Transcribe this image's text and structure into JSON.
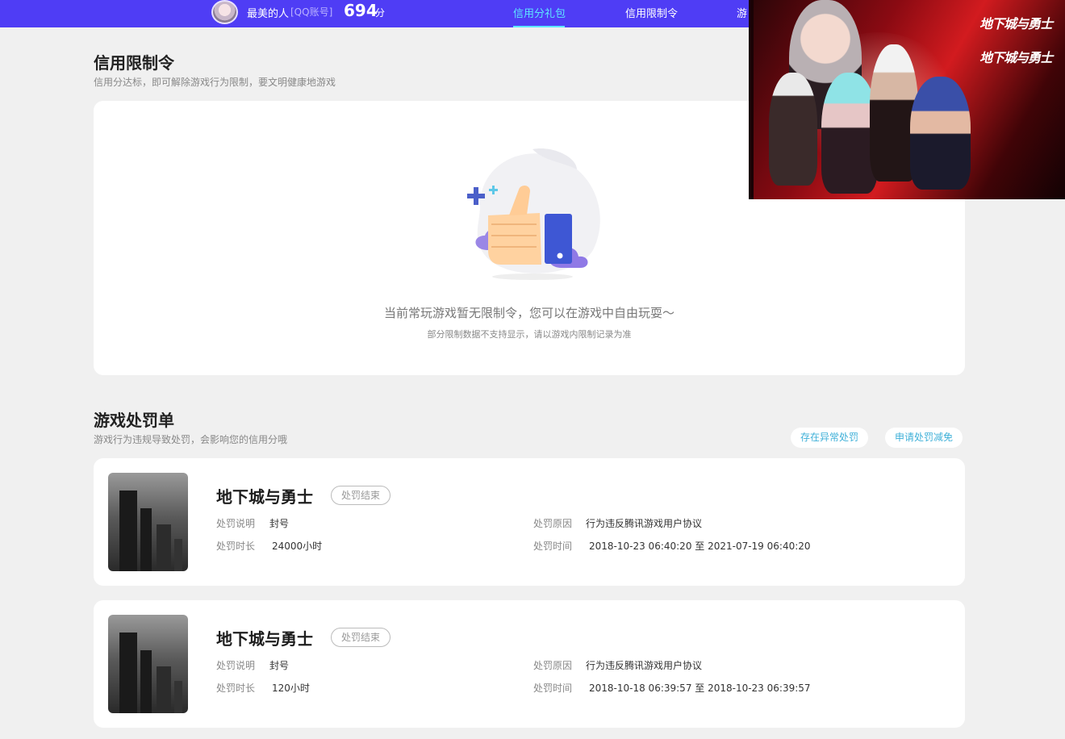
{
  "header": {
    "username": "最美的人",
    "account_tag": "[QQ账号]",
    "score": "694",
    "score_unit": "分",
    "nav": [
      {
        "label": "信用分礼包",
        "active": true
      },
      {
        "label": "信用限制令",
        "active": false
      },
      {
        "label": "游",
        "active": false
      }
    ]
  },
  "ad": {
    "logo_1": "地下城与勇士",
    "logo_2": "地下城与勇士"
  },
  "restriction": {
    "title": "信用限制令",
    "subtitle": "信用分达标，即可解除游戏行为限制，要文明健康地游戏",
    "empty_main": "当前常玩游戏暂无限制令，您可以在游戏中自由玩耍～",
    "empty_sub": "部分限制数据不支持显示，请以游戏内限制记录为准"
  },
  "punishments": {
    "title": "游戏处罚单",
    "subtitle": "游戏行为违规导致处罚，会影响您的信用分哦",
    "btn_abnormal": "存在异常处罚",
    "btn_reduce": "申请处罚减免",
    "labels": {
      "desc": "处罚说明",
      "duration": "处罚时长",
      "reason": "处罚原因",
      "time": "处罚时间"
    },
    "items": [
      {
        "game": "地下城与勇士",
        "status": "处罚结束",
        "desc": "封号",
        "duration": "24000小时",
        "reason": "行为违反腾讯游戏用户协议",
        "time": "2018-10-23 06:40:20 至 2021-07-19 06:40:20"
      },
      {
        "game": "地下城与勇士",
        "status": "处罚结束",
        "desc": "封号",
        "duration": "120小时",
        "reason": "行为违反腾讯游戏用户协议",
        "time": "2018-10-18 06:39:57 至 2018-10-23 06:39:57"
      }
    ]
  }
}
